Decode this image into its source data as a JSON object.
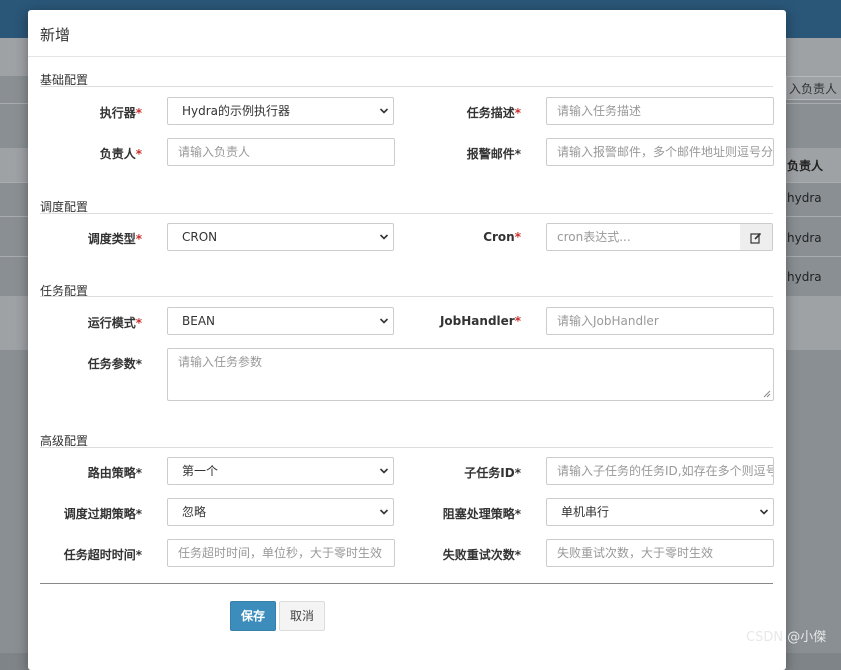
{
  "modal": {
    "title": "新增",
    "sections": {
      "basic": "基础配置",
      "schedule": "调度配置",
      "task": "任务配置",
      "advanced": "高级配置"
    },
    "fields": {
      "executor": {
        "label": "执行器",
        "value": "Hydra的示例执行器"
      },
      "task_desc": {
        "label": "任务描述",
        "placeholder": "请输入任务描述"
      },
      "owner": {
        "label": "负责人",
        "placeholder": "请输入负责人"
      },
      "alarm_email": {
        "label": "报警邮件",
        "placeholder": "请输入报警邮件，多个邮件地址则逗号分隔"
      },
      "schedule_type": {
        "label": "调度类型",
        "value": "CRON"
      },
      "cron": {
        "label": "Cron",
        "placeholder": "cron表达式..."
      },
      "run_mode": {
        "label": "运行模式",
        "value": "BEAN"
      },
      "job_handler": {
        "label": "JobHandler",
        "placeholder": "请输入JobHandler"
      },
      "task_param": {
        "label": "任务参数",
        "placeholder": "请输入任务参数"
      },
      "route_strategy": {
        "label": "路由策略",
        "value": "第一个"
      },
      "child_job_id": {
        "label": "子任务ID",
        "placeholder": "请输入子任务的任务ID,如存在多个则逗号分隔"
      },
      "misfire_strategy": {
        "label": "调度过期策略",
        "value": "忽略"
      },
      "block_strategy": {
        "label": "阻塞处理策略",
        "value": "单机串行"
      },
      "timeout": {
        "label": "任务超时时间",
        "placeholder": "任务超时时间，单位秒，大于零时生效"
      },
      "retry_count": {
        "label": "失败重试次数",
        "placeholder": "失败重试次数，大于零时生效"
      }
    },
    "required_mark": "*",
    "buttons": {
      "save": "保存",
      "cancel": "取消"
    }
  },
  "background": {
    "owner_input_fragment": "入负责人",
    "owner_column_header": "负责人",
    "rows": [
      "hydra",
      "hydra",
      "hydra"
    ]
  },
  "watermark": "CSDN @小傑"
}
